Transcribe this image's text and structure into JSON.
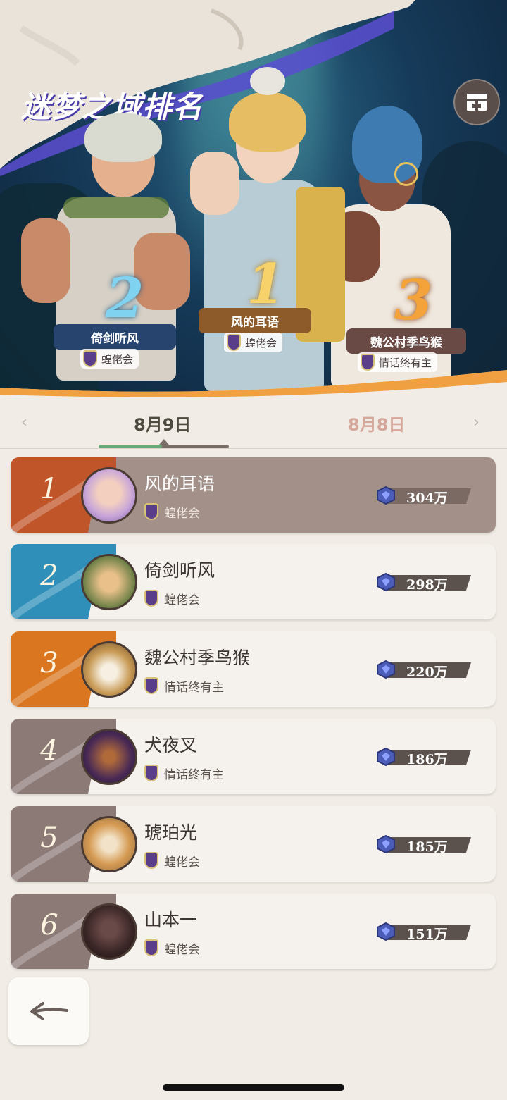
{
  "hero": {
    "title": "迷梦之域排名",
    "podium": [
      {
        "rank": "2",
        "name": "倚剑听风",
        "guild": "蝗佬会"
      },
      {
        "rank": "1",
        "name": "风的耳语",
        "guild": "蝗佬会"
      },
      {
        "rank": "3",
        "name": "魏公村季鸟猴",
        "guild": "情话终有主"
      }
    ]
  },
  "tabs": {
    "active": "8月9日",
    "inactive": "8月8日",
    "prev_arrow": "‹",
    "next_arrow": "›"
  },
  "rows": [
    {
      "rank": "1",
      "name": "风的耳语",
      "guild": "蝗佬会",
      "score": "304万"
    },
    {
      "rank": "2",
      "name": "倚剑听风",
      "guild": "蝗佬会",
      "score": "298万"
    },
    {
      "rank": "3",
      "name": "魏公村季鸟猴",
      "guild": "情话终有主",
      "score": "220万"
    },
    {
      "rank": "4",
      "name": "犬夜叉",
      "guild": "情话终有主",
      "score": "186万"
    },
    {
      "rank": "5",
      "name": "琥珀光",
      "guild": "蝗佬会",
      "score": "185万"
    },
    {
      "rank": "6",
      "name": "山本一",
      "guild": "蝗佬会",
      "score": "151万"
    }
  ],
  "colors": {
    "rank1": "#c0552a",
    "rank2": "#2f8fb8",
    "rank3": "#d9761f",
    "rank_other": "#8c7a77"
  },
  "icons": {
    "back": "back-arrow-icon",
    "hero_button": "gallery-icon",
    "guild": "guild-shield-icon",
    "score": "gem-icon"
  }
}
